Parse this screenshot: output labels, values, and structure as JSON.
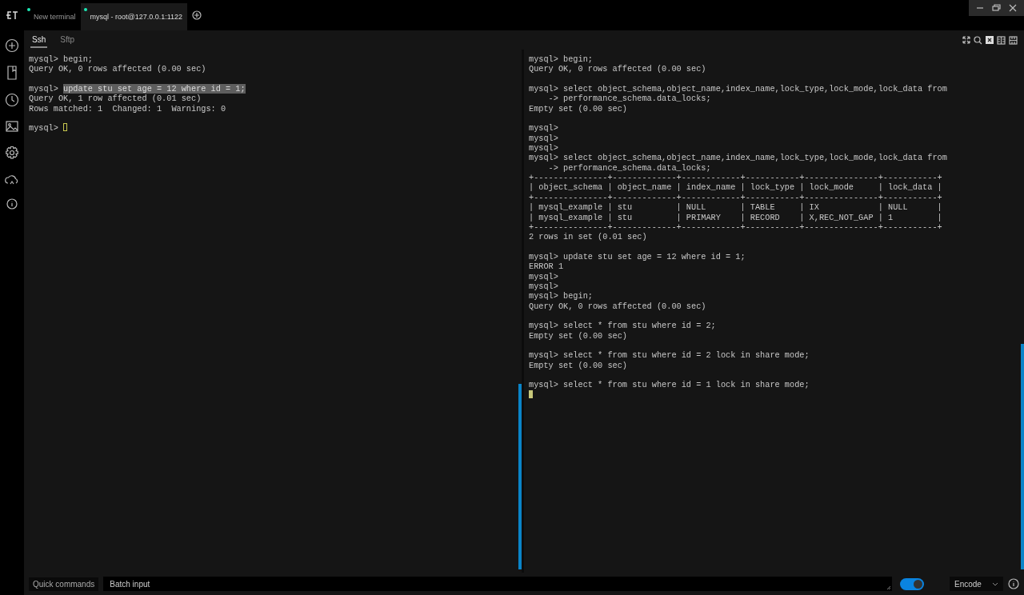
{
  "tabs": [
    {
      "label": "New terminal",
      "selected": false
    },
    {
      "label": "mysql - root@127.0.0.1:1122",
      "selected": true
    }
  ],
  "sub_tabs": [
    {
      "label": "Ssh",
      "selected": true
    },
    {
      "label": "Sftp",
      "selected": false
    }
  ],
  "panes": [
    {
      "focused": false,
      "lines": [
        {
          "kind": "text",
          "text": "mysql> begin;"
        },
        {
          "kind": "text",
          "text": "Query OK, 0 rows affected (0.00 sec)"
        },
        {
          "kind": "blank"
        },
        {
          "kind": "highlight",
          "text": "mysql> ",
          "highlight": "update stu set age = 12 where id = 1;"
        },
        {
          "kind": "text",
          "text": "Query OK, 1 row affected (0.01 sec)"
        },
        {
          "kind": "text",
          "text": "Rows matched: 1  Changed: 1  Warnings: 0"
        },
        {
          "kind": "blank"
        },
        {
          "kind": "cursor",
          "text": "mysql> "
        }
      ]
    },
    {
      "focused": true,
      "lines": [
        {
          "kind": "text",
          "text": "mysql> begin;"
        },
        {
          "kind": "text",
          "text": "Query OK, 0 rows affected (0.00 sec)"
        },
        {
          "kind": "blank"
        },
        {
          "kind": "text",
          "text": "mysql> select object_schema,object_name,index_name,lock_type,lock_mode,lock_data from"
        },
        {
          "kind": "text",
          "text": "    -> performance_schema.data_locks;"
        },
        {
          "kind": "text",
          "text": "Empty set (0.00 sec)"
        },
        {
          "kind": "blank"
        },
        {
          "kind": "text",
          "text": "mysql>"
        },
        {
          "kind": "text",
          "text": "mysql>"
        },
        {
          "kind": "text",
          "text": "mysql>"
        },
        {
          "kind": "text",
          "text": "mysql> select object_schema,object_name,index_name,lock_type,lock_mode,lock_data from"
        },
        {
          "kind": "text",
          "text": "    -> performance_schema.data_locks;"
        },
        {
          "kind": "text",
          "text": "+---------------+-------------+------------+-----------+---------------+-----------+"
        },
        {
          "kind": "text",
          "text": "| object_schema | object_name | index_name | lock_type | lock_mode     | lock_data |"
        },
        {
          "kind": "text",
          "text": "+---------------+-------------+------------+-----------+---------------+-----------+"
        },
        {
          "kind": "text",
          "text": "| mysql_example | stu         | NULL       | TABLE     | IX            | NULL      |"
        },
        {
          "kind": "text",
          "text": "| mysql_example | stu         | PRIMARY    | RECORD    | X,REC_NOT_GAP | 1         |"
        },
        {
          "kind": "text",
          "text": "+---------------+-------------+------------+-----------+---------------+-----------+"
        },
        {
          "kind": "text",
          "text": "2 rows in set (0.01 sec)"
        },
        {
          "kind": "blank"
        },
        {
          "kind": "text",
          "text": "mysql> update stu set age = 12 where id = 1;"
        },
        {
          "kind": "text",
          "text": "ERROR 1"
        },
        {
          "kind": "text",
          "text": "mysql>"
        },
        {
          "kind": "text",
          "text": "mysql>"
        },
        {
          "kind": "text",
          "text": "mysql> begin;"
        },
        {
          "kind": "text",
          "text": "Query OK, 0 rows affected (0.00 sec)"
        },
        {
          "kind": "blank"
        },
        {
          "kind": "text",
          "text": "mysql> select * from stu where id = 2;"
        },
        {
          "kind": "text",
          "text": "Empty set (0.00 sec)"
        },
        {
          "kind": "blank"
        },
        {
          "kind": "text",
          "text": "mysql> select * from stu where id = 2 lock in share mode;"
        },
        {
          "kind": "text",
          "text": "Empty set (0.00 sec)"
        },
        {
          "kind": "blank"
        },
        {
          "kind": "text",
          "text": "mysql> select * from stu where id = 1 lock in share mode;"
        },
        {
          "kind": "cursor"
        }
      ]
    }
  ],
  "footer": {
    "quick_commands": "Quick commands",
    "batch_input": {
      "placeholder": "Batch input"
    },
    "toggle": {
      "on": true
    },
    "encode": "Encode"
  }
}
